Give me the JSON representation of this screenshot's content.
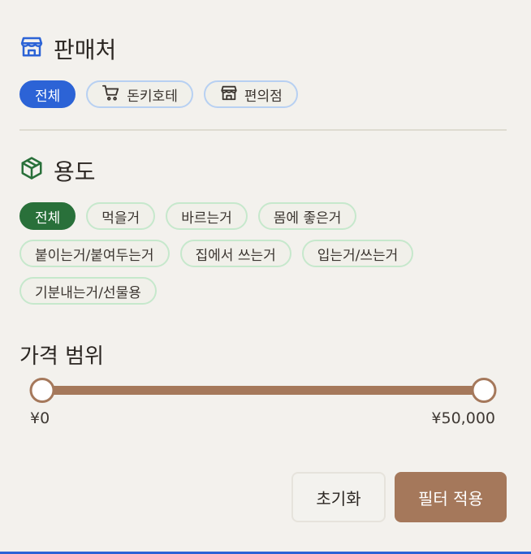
{
  "seller": {
    "title": "판매처",
    "icon": "store-icon",
    "accent": "#2c63d6",
    "chips": [
      {
        "label": "전체",
        "active": true
      },
      {
        "label": "돈키호테",
        "icon": "cart-icon",
        "active": false
      },
      {
        "label": "편의점",
        "icon": "store-icon",
        "active": false
      }
    ]
  },
  "usage": {
    "title": "용도",
    "icon": "box-icon",
    "accent": "#29703a",
    "chips": [
      {
        "label": "전체",
        "active": true
      },
      {
        "label": "먹을거",
        "active": false
      },
      {
        "label": "바르는거",
        "active": false
      },
      {
        "label": "몸에 좋은거",
        "active": false
      },
      {
        "label": "붙이는거/붙여두는거",
        "active": false
      },
      {
        "label": "집에서 쓰는거",
        "active": false
      },
      {
        "label": "입는거/쓰는거",
        "active": false
      },
      {
        "label": "기분내는거/선물용",
        "active": false
      }
    ]
  },
  "price": {
    "title": "가격 범위",
    "min_label": "¥0",
    "max_label": "¥50,000",
    "range_min": 0,
    "range_max": 50000,
    "value_low": 0,
    "value_high": 50000,
    "accent": "#a5785b"
  },
  "actions": {
    "reset_label": "초기화",
    "apply_label": "필터 적용"
  }
}
